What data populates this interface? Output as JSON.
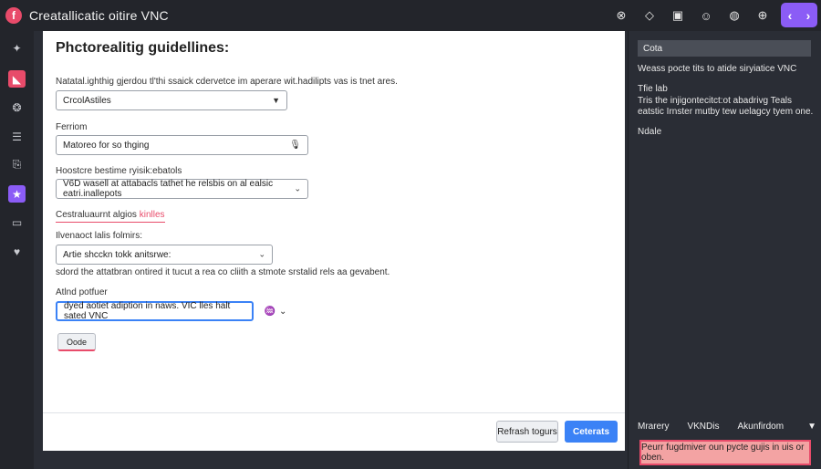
{
  "window": {
    "title": "Creatallicatic oitire VNC",
    "logo_glyph": "f"
  },
  "toolbar": {
    "icons": [
      {
        "name": "close-circle-icon",
        "glyph": "⊗"
      },
      {
        "name": "dropbox-icon",
        "glyph": "◇"
      },
      {
        "name": "image-icon",
        "glyph": "▣"
      },
      {
        "name": "people-icon",
        "glyph": "☺"
      },
      {
        "name": "globe-icon",
        "glyph": "◍"
      },
      {
        "name": "zoom-icon",
        "glyph": "⊕"
      }
    ],
    "nav_prev": "‹",
    "nav_next": "›"
  },
  "rail": {
    "items": [
      {
        "name": "sparkle-icon",
        "glyph": "✦",
        "style": ""
      },
      {
        "name": "notes-icon",
        "glyph": "◣",
        "style": "red"
      },
      {
        "name": "brain-icon",
        "glyph": "❂",
        "style": ""
      },
      {
        "name": "list-icon",
        "glyph": "☰",
        "style": ""
      },
      {
        "name": "clipboard-icon",
        "glyph": "⎘",
        "style": ""
      },
      {
        "name": "star-icon",
        "glyph": "★",
        "style": "purple"
      },
      {
        "name": "message-icon",
        "glyph": "▭",
        "style": ""
      },
      {
        "name": "heart-icon",
        "glyph": "♥",
        "style": ""
      }
    ]
  },
  "main": {
    "title": "Phctorealitig guidellines:",
    "description": "Natatal.ighthig gjerdou tl'thi ssaick cdervetce im aperare wit.hadilipts vas is tnet ares.",
    "select1": {
      "value": "CrcolAstiles"
    },
    "field2": {
      "label": "Ferriom",
      "value": "Matoreo for so thging"
    },
    "field3": {
      "label": "Hoostcre bestime ryisik:ebatols",
      "value": "V6D wasell at attabacls tathet he relsbis on al ealsic eatri.inallepots"
    },
    "section": {
      "text": "Cestraluaurnt algios ",
      "accent": "kinlles"
    },
    "field4": {
      "label": "Ilvenaoct lalis folmirs:",
      "value": "Artie shcckn tokk anitsrwe:"
    },
    "hint": "sdord the attatbran ontired it tucut a rea co cliith a stmote srstalid rels aa gevabent.",
    "field5": {
      "label": "Atlnd potfuer",
      "value": "dyed aotiet adiption in naws. VIC lles halt sated VNC"
    },
    "small_select": {
      "glyph": "♒",
      "caret": "⌄"
    },
    "code_button": "Oode"
  },
  "footer": {
    "secondary_label": "Refrash togurs",
    "primary_label": "Ceterats"
  },
  "right_panel": {
    "heading": "Cota",
    "line1": "Weass pocte tits to atide siryiatice VNC",
    "block_title": "Tfie lab",
    "block_body": "Tris the injigontecitct:ot abadrivg Teals eatstic Irnster mutby tew uelagcy tyem one.",
    "label": "Ndale",
    "tabs": [
      "Mrarery",
      "VKNDis",
      "Akunfirdom"
    ],
    "tab_caret": "▼",
    "banner": "Peurr fugdmiver oun pycte gujis in uis or oben."
  }
}
